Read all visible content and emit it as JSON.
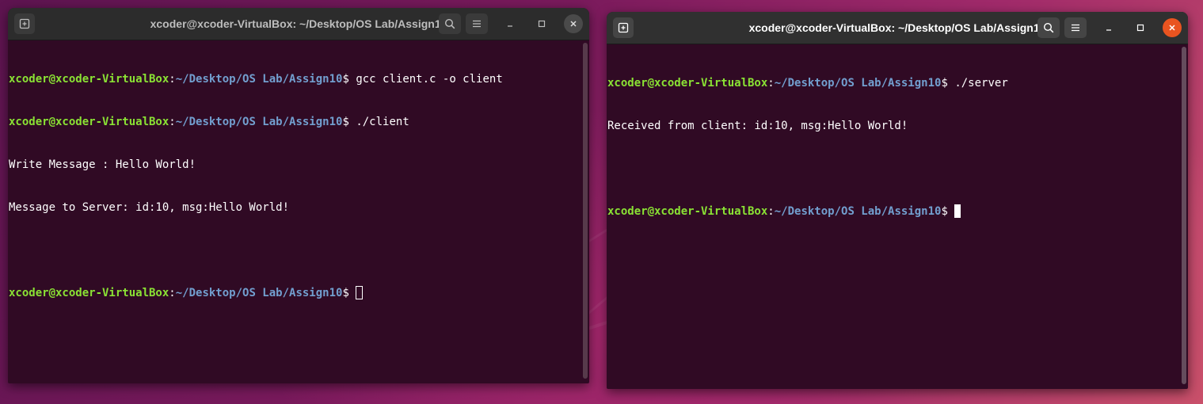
{
  "windows": [
    {
      "title": "xcoder@xcoder-VirtualBox: ~/Desktop/OS Lab/Assign10",
      "focused": false,
      "lines": [
        {
          "type": "prompt",
          "user": "xcoder@xcoder-VirtualBox",
          "path": "~/Desktop/OS Lab/Assign10",
          "symbol": "$ ",
          "cmd": "gcc client.c -o client"
        },
        {
          "type": "prompt",
          "user": "xcoder@xcoder-VirtualBox",
          "path": "~/Desktop/OS Lab/Assign10",
          "symbol": "$ ",
          "cmd": "./client"
        },
        {
          "type": "output",
          "text": "Write Message : Hello World!"
        },
        {
          "type": "output",
          "text": "Message to Server: id:10, msg:Hello World!"
        },
        {
          "type": "output",
          "text": ""
        },
        {
          "type": "prompt",
          "user": "xcoder@xcoder-VirtualBox",
          "path": "~/Desktop/OS Lab/Assign10",
          "symbol": "$ ",
          "cmd": ""
        }
      ]
    },
    {
      "title": "xcoder@xcoder-VirtualBox: ~/Desktop/OS Lab/Assign10",
      "focused": true,
      "lines": [
        {
          "type": "prompt",
          "user": "xcoder@xcoder-VirtualBox",
          "path": "~/Desktop/OS Lab/Assign10",
          "symbol": "$ ",
          "cmd": "./server"
        },
        {
          "type": "output",
          "text": "Received from client: id:10, msg:Hello World!"
        },
        {
          "type": "output",
          "text": ""
        },
        {
          "type": "prompt",
          "user": "xcoder@xcoder-VirtualBox",
          "path": "~/Desktop/OS Lab/Assign10",
          "symbol": "$ ",
          "cmd": ""
        }
      ]
    }
  ],
  "colors": {
    "terminal_bg": "#300a24",
    "prompt_user": "#8ae234",
    "prompt_path": "#729fcf",
    "close_active": "#e95420"
  },
  "icons": {
    "new_tab": "new-tab-icon",
    "search": "search-icon",
    "menu": "hamburger-menu-icon",
    "minimize": "minimize-icon",
    "maximize": "maximize-icon",
    "close": "close-icon"
  }
}
